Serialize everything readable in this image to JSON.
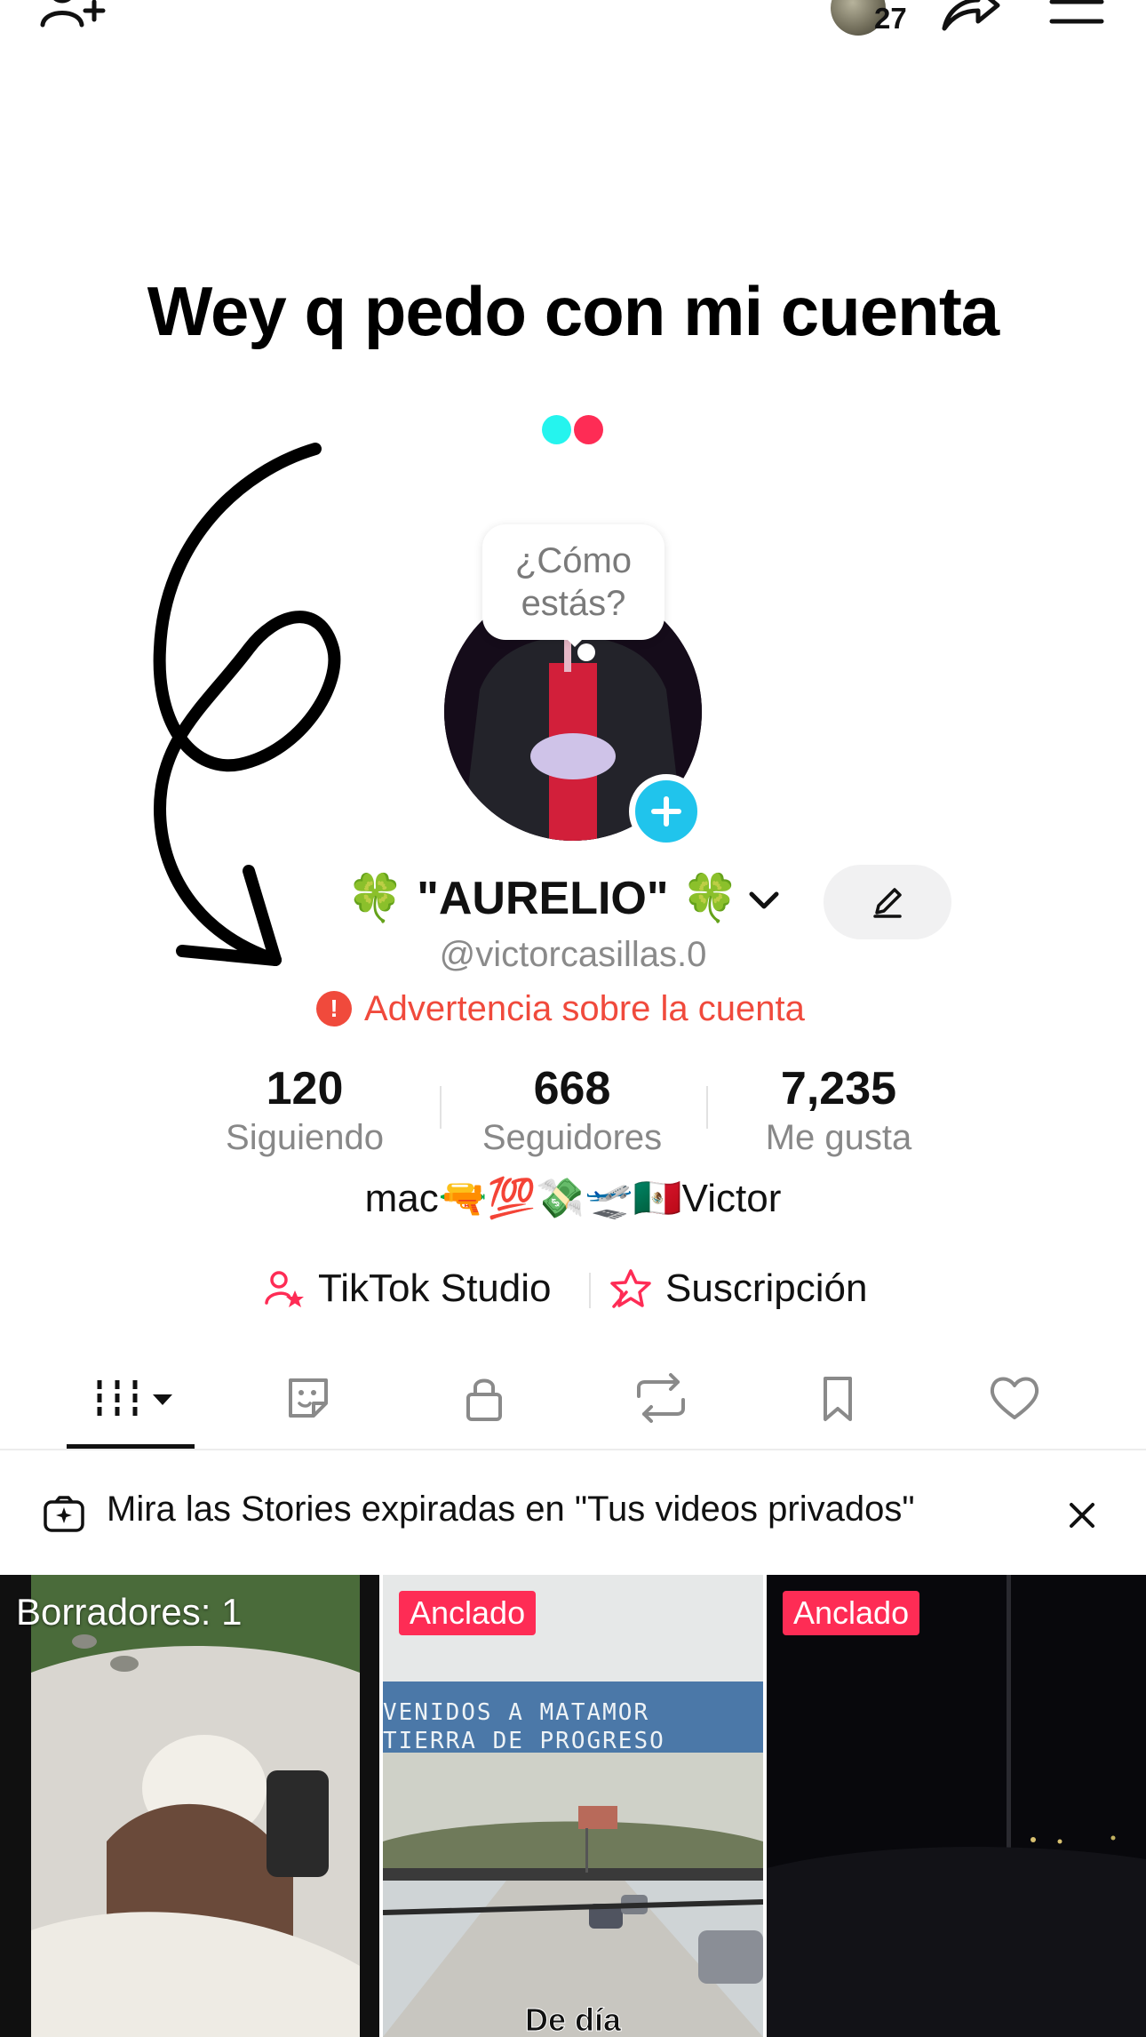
{
  "header": {
    "add_friend_icon": "person-add-icon",
    "friends_count": "27",
    "share_icon": "share-icon",
    "menu_icon": "hamburger-menu-icon"
  },
  "caption": "Wey q pedo con mi cuenta",
  "status_bubble": "¿Cómo estás?",
  "profile": {
    "display_name": "🍀 \"AURELIO\" 🍀",
    "handle": "@victorcasillas.0",
    "warning": "Advertencia sobre la cuenta",
    "bio": "mac🔫💯💸🛫🇲🇽Victor"
  },
  "stats": [
    {
      "value": "120",
      "label": "Siguiendo"
    },
    {
      "value": "668",
      "label": "Seguidores"
    },
    {
      "value": "7,235",
      "label": "Me gusta"
    }
  ],
  "links": {
    "studio": "TikTok Studio",
    "subscription": "Suscripción"
  },
  "tabs": [
    "videos-tab",
    "stickers-tab",
    "private-tab",
    "reposts-tab",
    "saved-tab",
    "liked-tab"
  ],
  "banner": {
    "text": "Mira las Stories expiradas en \"Tus videos privados\""
  },
  "grid": {
    "drafts_label": "Borradores: 1",
    "pinned_label_1": "Anclado",
    "pinned_label_2": "Anclado",
    "sign_line_1": "VENIDOS A MATAMOR",
    "sign_line_2": "TIERRA DE PROGRESO",
    "subtitle": "De día"
  },
  "colors": {
    "accent_red": "#fe2c55",
    "warning_red": "#f04a3c",
    "accent_cyan": "#20c4ec"
  }
}
